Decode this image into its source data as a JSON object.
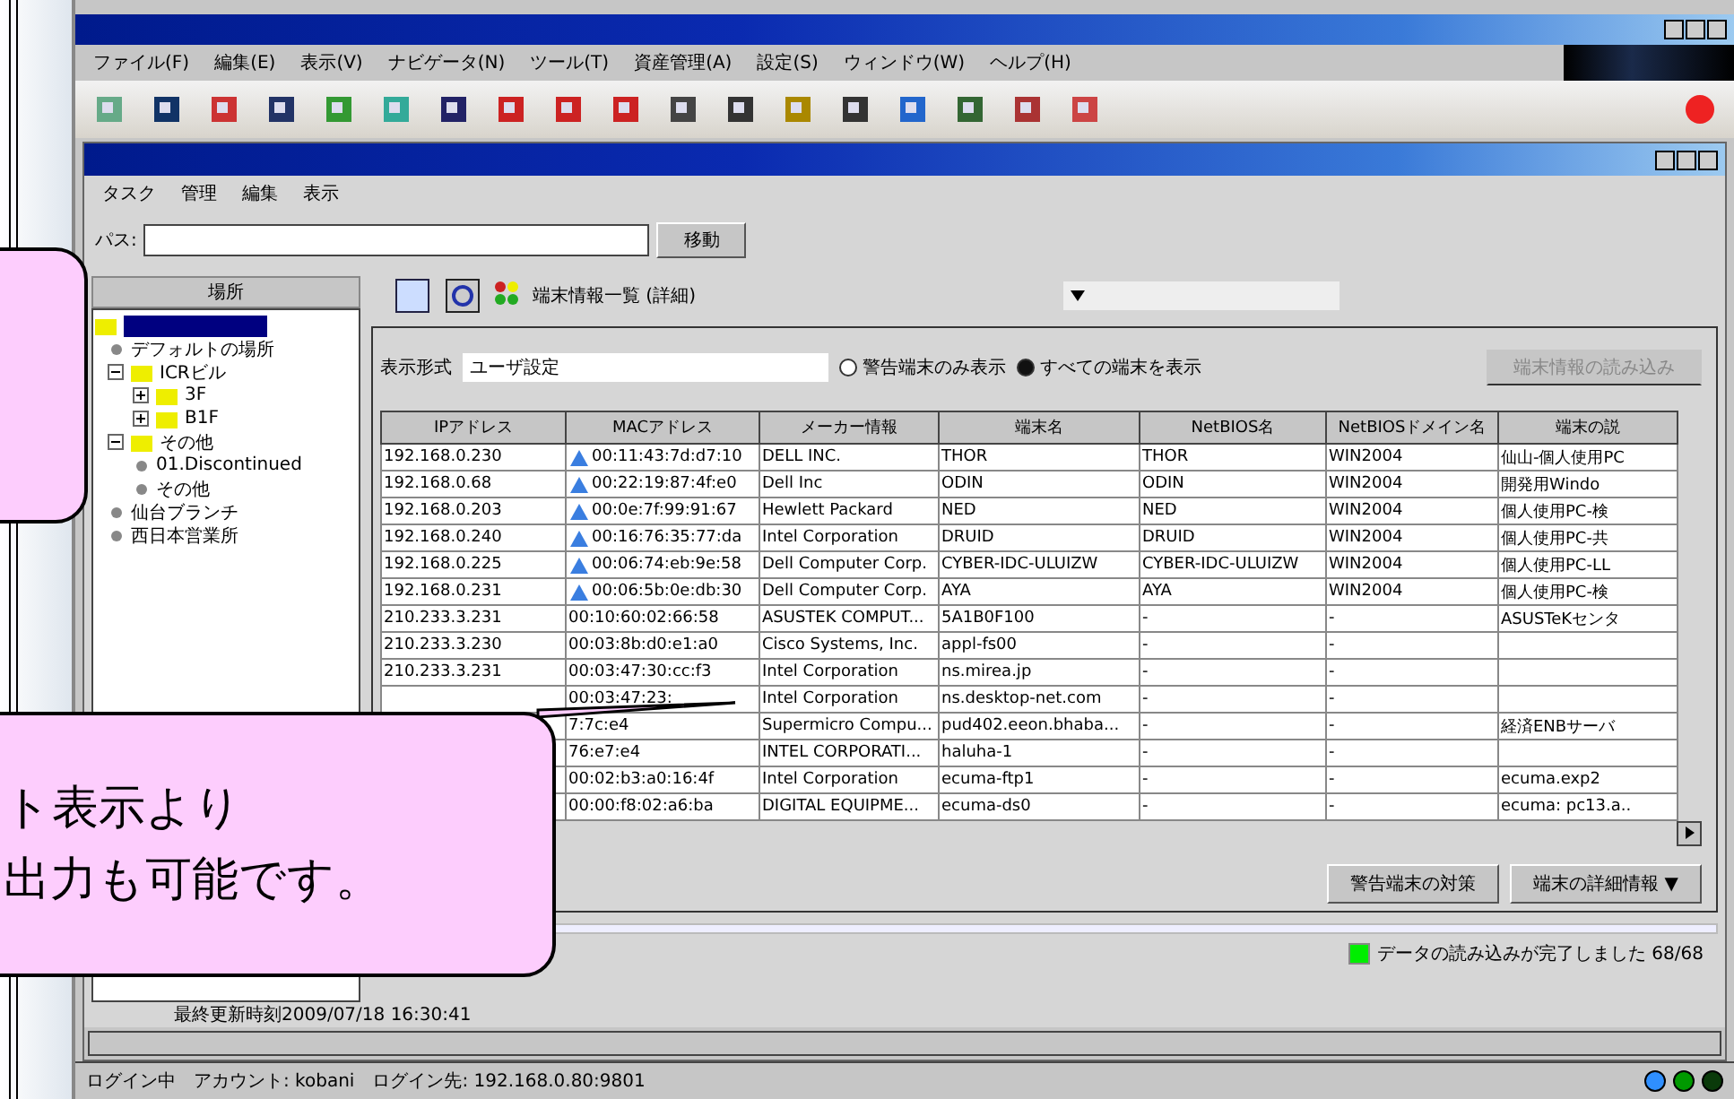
{
  "menu": [
    "ファイル(F)",
    "編集(E)",
    "表示(V)",
    "ナビゲータ(N)",
    "ツール(T)",
    "資産管理(A)",
    "設定(S)",
    "ウィンドウ(W)",
    "ヘルプ(H)"
  ],
  "inner_menu": [
    "タスク",
    "管理",
    "編集",
    "表示"
  ],
  "path": {
    "label": "パス:",
    "button": "移動"
  },
  "tree": {
    "header": "場所",
    "root_selected": true,
    "items": [
      {
        "label": "デフォルトの場所",
        "kind": "place"
      },
      {
        "label": "ICRビル",
        "kind": "folder",
        "expanded": true,
        "children": [
          {
            "label": "3F",
            "kind": "folder",
            "expanded": false
          },
          {
            "label": "B1F",
            "kind": "folder",
            "expanded": false
          }
        ]
      },
      {
        "label": "その他",
        "kind": "folder",
        "expanded": true,
        "children": [
          {
            "label": "01.Discontinued",
            "kind": "place"
          },
          {
            "label": "その他",
            "kind": "place"
          }
        ]
      },
      {
        "label": "仙台ブランチ",
        "kind": "place"
      },
      {
        "label": "西日本営業所",
        "kind": "place"
      }
    ]
  },
  "view_title": "端末情報一覧 (詳細)",
  "filter": {
    "label": "表示形式",
    "value": "ユーザ設定",
    "radios": [
      {
        "label": "警告端末のみ表示",
        "selected": false
      },
      {
        "label": "すべての端末を表示",
        "selected": true
      }
    ],
    "button": "端末情報の読み込み",
    "button_disabled": true
  },
  "table": {
    "columns": [
      "IPアドレス",
      "MACアドレス",
      "メーカー情報",
      "端末名",
      "NetBIOS名",
      "NetBIOSドメイン名",
      "端末の説"
    ],
    "rows": [
      {
        "ip": "192.168.0.230",
        "mac": "00:11:43:7d:d7:10",
        "vendor": "DELL INC.",
        "name": "THOR",
        "netbios": "THOR",
        "domain": "WIN2004",
        "desc": "仙山-個人使用PC"
      },
      {
        "ip": "192.168.0.68",
        "mac": "00:22:19:87:4f:e0",
        "vendor": "Dell Inc",
        "name": "ODIN",
        "netbios": "ODIN",
        "domain": "WIN2004",
        "desc": "開発用Windo"
      },
      {
        "ip": "192.168.0.203",
        "mac": "00:0e:7f:99:91:67",
        "vendor": "Hewlett Packard",
        "name": "NED",
        "netbios": "NED",
        "domain": "WIN2004",
        "desc": "個人使用PC-検"
      },
      {
        "ip": "192.168.0.240",
        "mac": "00:16:76:35:77:da",
        "vendor": "Intel Corporation",
        "name": "DRUID",
        "netbios": "DRUID",
        "domain": "WIN2004",
        "desc": "個人使用PC-共"
      },
      {
        "ip": "192.168.0.225",
        "mac": "00:06:74:eb:9e:58",
        "vendor": "Dell Computer Corp.",
        "name": "CYBER-IDC-ULUIZW",
        "netbios": "CYBER-IDC-ULUIZW",
        "domain": "WIN2004",
        "desc": "個人使用PC-LL"
      },
      {
        "ip": "192.168.0.231",
        "mac": "00:06:5b:0e:db:30",
        "vendor": "Dell Computer Corp.",
        "name": "AYA",
        "netbios": "AYA",
        "domain": "WIN2004",
        "desc": "個人使用PC-検"
      },
      {
        "ip": "210.233.3.231",
        "mac": "00:10:60:02:66:58",
        "vendor": "ASUSTEK COMPUT...",
        "name": "5A1B0F100",
        "netbios": "-",
        "domain": "-",
        "desc": "ASUSTeKセンタ"
      },
      {
        "ip": "210.233.3.230",
        "mac": "00:03:8b:d0:e1:a0",
        "vendor": "Cisco Systems, Inc.",
        "name": "appl-fs00",
        "netbios": "-",
        "domain": "-",
        "desc": ""
      },
      {
        "ip": "210.233.3.231",
        "mac": "00:03:47:30:cc:f3",
        "vendor": "Intel Corporation",
        "name": "ns.mirea.jp",
        "netbios": "-",
        "domain": "-",
        "desc": ""
      },
      {
        "ip": "",
        "mac": "00:03:47:23:",
        "vendor": "Intel Corporation",
        "name": "ns.desktop-net.com",
        "netbios": "-",
        "domain": "-",
        "desc": ""
      },
      {
        "ip": "",
        "mac": "7:7c:e4",
        "vendor": "Supermicro Compu...",
        "name": "pud402.eeon.bhaba...",
        "netbios": "-",
        "domain": "-",
        "desc": "経済ENBサーバ"
      },
      {
        "ip": "",
        "mac": "76:e7:e4",
        "vendor": "INTEL CORPORATI...",
        "name": "haluha-1",
        "netbios": "-",
        "domain": "-",
        "desc": ""
      },
      {
        "ip": "",
        "mac": "00:02:b3:a0:16:4f",
        "vendor": "Intel Corporation",
        "name": "ecuma-ftp1",
        "netbios": "-",
        "domain": "-",
        "desc": "ecuma.exp2"
      },
      {
        "ip": "",
        "mac": "00:00:f8:02:a6:ba",
        "vendor": "DIGITAL EQUIPME...",
        "name": "ecuma-ds0",
        "netbios": "-",
        "domain": "-",
        "desc": "ecuma: pc13.a.."
      }
    ]
  },
  "actions": [
    "警告端末の対策",
    "端末の詳細情報 ▼"
  ],
  "progress": {
    "level": 1
  },
  "last_update": "最終更新時刻2009/07/18 16:30:41",
  "load_status": {
    "text": "データの読み込みが完了しました 68/68",
    "color": "#00ee00"
  },
  "status_bar": "ログイン中　アカウント: kobani　ログイン先: 192.168.0.80:9801",
  "indicators": [
    {
      "color": "#2f8fff"
    },
    {
      "color": "#009900"
    },
    {
      "color": "#0a3a0a"
    }
  ],
  "callout": {
    "lines": [
      "ト表示より",
      "出力も可能です。"
    ]
  }
}
